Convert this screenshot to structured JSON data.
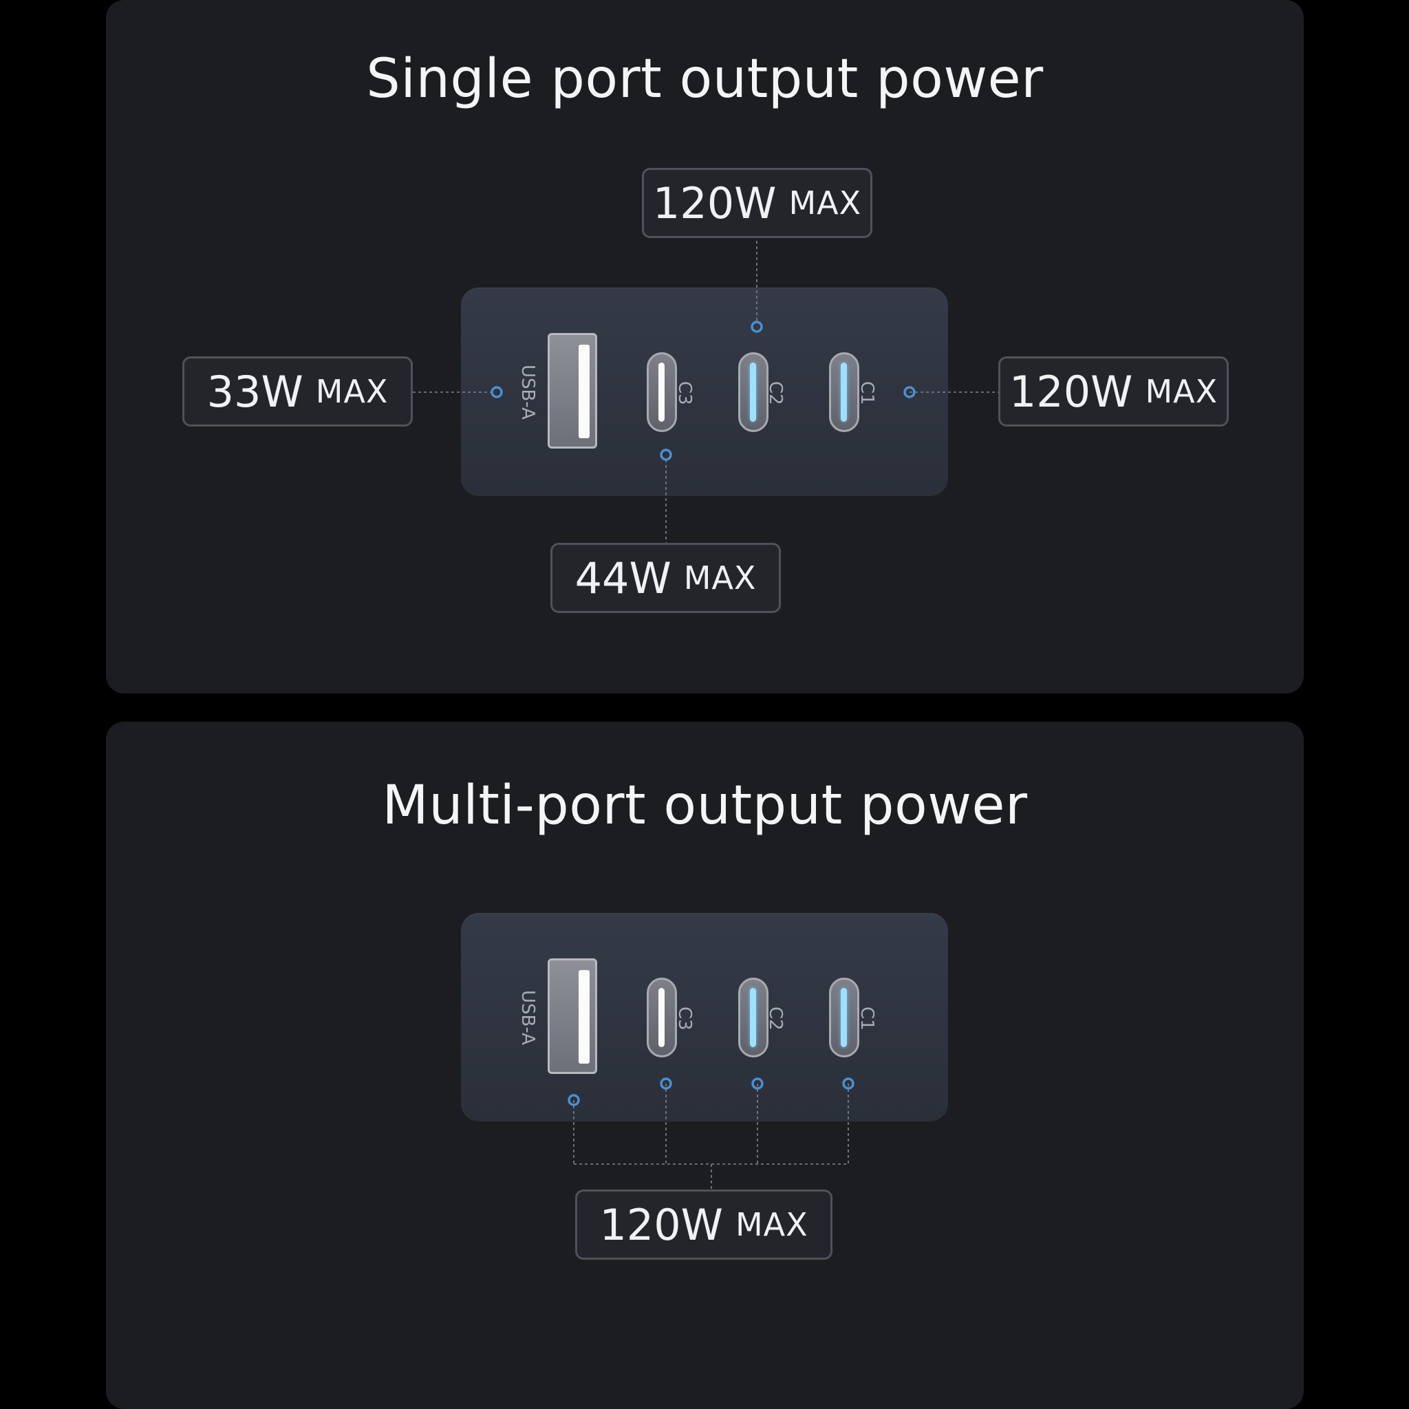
{
  "single": {
    "title": "Single port output power",
    "ports": {
      "usba_label": "USB-A",
      "c3_label": "C3",
      "c2_label": "C2",
      "c1_label": "C1"
    },
    "callouts": {
      "c2": {
        "watt": "120W",
        "unit": "MAX"
      },
      "usba": {
        "watt": "33W",
        "unit": "MAX"
      },
      "c1": {
        "watt": "120W",
        "unit": "MAX"
      },
      "c3": {
        "watt": "44W",
        "unit": "MAX"
      }
    }
  },
  "multi": {
    "title": "Multi-port output power",
    "ports": {
      "usba_label": "USB-A",
      "c3_label": "C3",
      "c2_label": "C2",
      "c1_label": "C1"
    },
    "callout": {
      "watt": "120W",
      "unit": "MAX"
    }
  },
  "colors": {
    "background": "#000000",
    "panel": "#1c1d21",
    "charger": "#2f3440",
    "connector_dot": "#4a90d0",
    "slot_blue": "#9fe0ff",
    "box_border": "#4f525a"
  }
}
